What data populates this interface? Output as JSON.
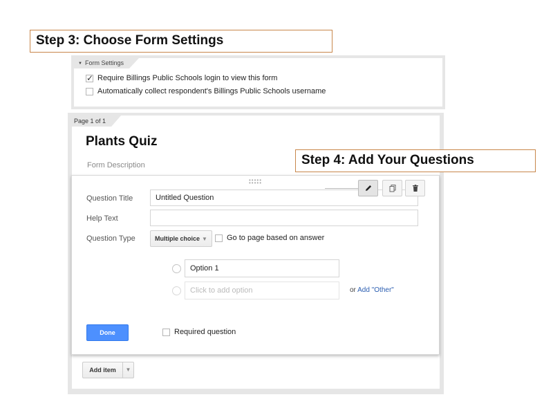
{
  "step3_label": "Step 3: Choose Form Settings",
  "step4_label": "Step 4: Add Your Questions",
  "form_settings": {
    "tab_label": "Form Settings",
    "require_login": {
      "label": "Require Billings Public Schools login to view this form",
      "checked": true
    },
    "collect_username": {
      "label": "Automatically collect respondent's Billings Public Schools username",
      "checked": false
    }
  },
  "page": {
    "indicator": "Page 1 of 1",
    "form_title": "Plants Quiz",
    "form_description_placeholder": "Form Description"
  },
  "question": {
    "title_label": "Question Title",
    "title_value": "Untitled Question",
    "help_label": "Help Text",
    "help_value": "",
    "type_label": "Question Type",
    "type_value": "Multiple choice",
    "goto_page_label": "Go to page based on answer",
    "options": [
      {
        "value": "Option 1"
      }
    ],
    "add_option_placeholder": "Click to add option",
    "add_other_prefix": "or",
    "add_other_link": "Add \"Other\"",
    "done_label": "Done",
    "required_label": "Required question"
  },
  "toolbar": {
    "edit_icon": "pencil-icon",
    "duplicate_icon": "duplicate-icon",
    "delete_icon": "trash-icon"
  },
  "add_item_label": "Add item",
  "colors": {
    "accent_blue": "#4d90fe",
    "link_blue": "#2a5db0",
    "step_border": "#c8864a"
  }
}
